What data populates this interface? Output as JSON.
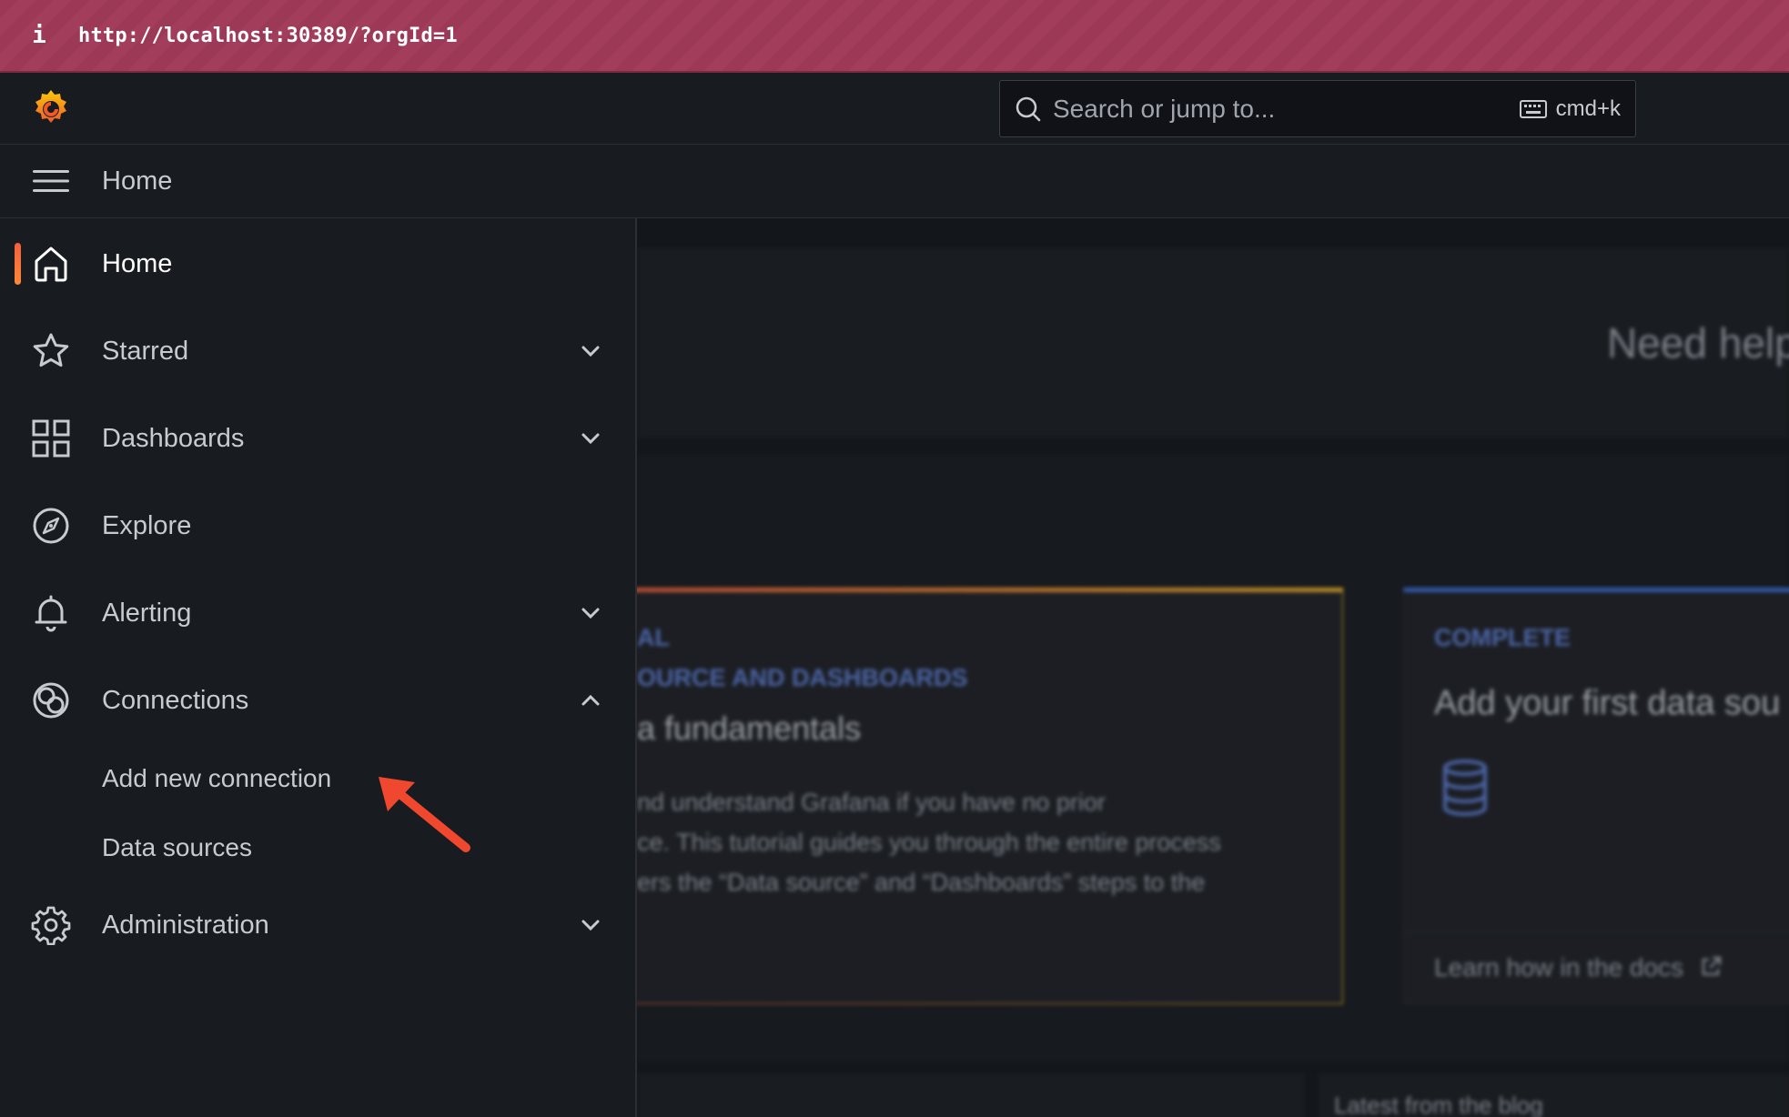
{
  "browser": {
    "info_glyph": "i",
    "url": "http://localhost:30389/?orgId=1"
  },
  "topbar": {
    "logo_icon": "grafana-logo-icon",
    "search_placeholder": "Search or jump to...",
    "search_shortcut": "cmd+k"
  },
  "breadcrumb": {
    "current": "Home"
  },
  "sidebar": {
    "items": [
      {
        "label": "Home",
        "icon": "home-icon",
        "active": true,
        "expandable": false
      },
      {
        "label": "Starred",
        "icon": "star-icon",
        "expandable": true,
        "expanded": false
      },
      {
        "label": "Dashboards",
        "icon": "apps-icon",
        "expandable": true,
        "expanded": false
      },
      {
        "label": "Explore",
        "icon": "compass-icon",
        "expandable": false
      },
      {
        "label": "Alerting",
        "icon": "bell-icon",
        "expandable": true,
        "expanded": false
      },
      {
        "label": "Connections",
        "icon": "connections-icon",
        "expandable": true,
        "expanded": true
      },
      {
        "label": "Administration",
        "icon": "cog-icon",
        "expandable": true,
        "expanded": false
      }
    ],
    "connections_sub": [
      {
        "label": "Add new connection"
      },
      {
        "label": "Data sources"
      }
    ]
  },
  "main": {
    "need_help": "Need help",
    "card1": {
      "tag1": "AL",
      "tag2": "OURCE AND DASHBOARDS",
      "title": "a fundamentals",
      "body": "nd understand Grafana if you have no prior\nce. This tutorial guides you through the entire process\ners the “Data source” and “Dashboards” steps to the"
    },
    "card2": {
      "tag": "COMPLETE",
      "title": "Add your first data sou",
      "icon": "database-icon",
      "link": "Learn how in the docs"
    },
    "blog_heading": "Latest from the blog"
  },
  "colors": {
    "accent_orange": "#f55f3e",
    "annotation_arrow": "#f0482e",
    "link_blue": "#5f7fd4"
  }
}
